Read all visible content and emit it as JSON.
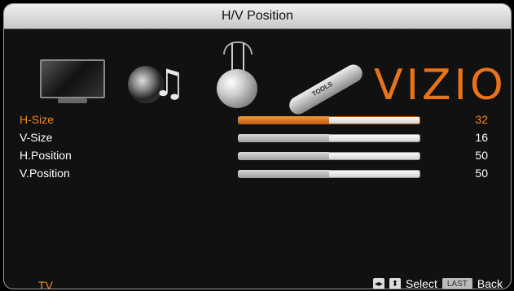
{
  "window": {
    "title": "H/V Position"
  },
  "menu_icons": [
    {
      "name": "tv-icon"
    },
    {
      "name": "audio-icon"
    },
    {
      "name": "network-icon"
    },
    {
      "name": "tools-icon"
    }
  ],
  "brand": {
    "text": "VIZIO",
    "color": "#e8731b"
  },
  "settings": [
    {
      "label": "H-Size",
      "value": "32",
      "fill_percent": 50,
      "selected": true
    },
    {
      "label": "V-Size",
      "value": "16",
      "fill_percent": 50,
      "selected": false
    },
    {
      "label": "H.Position",
      "value": "50",
      "fill_percent": 50,
      "selected": false
    },
    {
      "label": "V.Position",
      "value": "50",
      "fill_percent": 50,
      "selected": false
    }
  ],
  "footer": {
    "source": "TV",
    "select_label": "Select",
    "last_label": "LAST",
    "back_label": "Back"
  },
  "colors": {
    "accent": "#f08a24",
    "text": "#ffffff",
    "background": "#111111"
  }
}
